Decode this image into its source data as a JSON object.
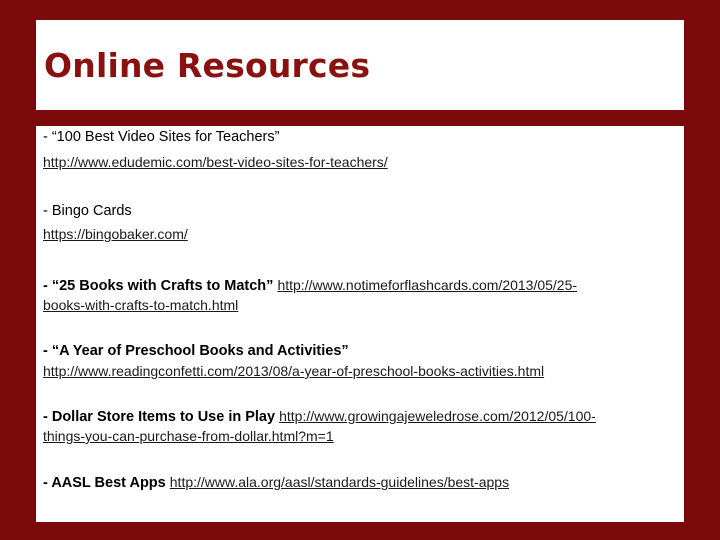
{
  "title": "Online Resources",
  "entries": [
    {
      "label": "- “100 Best Video Sites for Teachers”",
      "link": "http://www.edudemic.com/best-video-sites-for-teachers/"
    },
    {
      "label": "- Bingo Cards",
      "link": "https://bingobaker.com/"
    },
    {
      "label": "- “25 Books with Crafts to Match”",
      "link_part1": "http://www.notimeforflashcards.com/2013/05/25-",
      "link_part2": "books-with-crafts-to-match.html"
    },
    {
      "label": "- “A Year of Preschool Books and  Activities”",
      "link": "http://www.readingconfetti.com/2013/08/a-year-of-preschool-books-activities.html"
    },
    {
      "label": "- Dollar Store Items to Use in  Play",
      "link_part1": "http://www.growingajeweledrose.com/2012/05/100-",
      "link_part2": "things-you-can-purchase-from-dollar.html?m=1"
    },
    {
      "label": "- AASL Best  Apps",
      "link": "http://www.ala.org/aasl/standards-guidelines/best-apps"
    }
  ]
}
